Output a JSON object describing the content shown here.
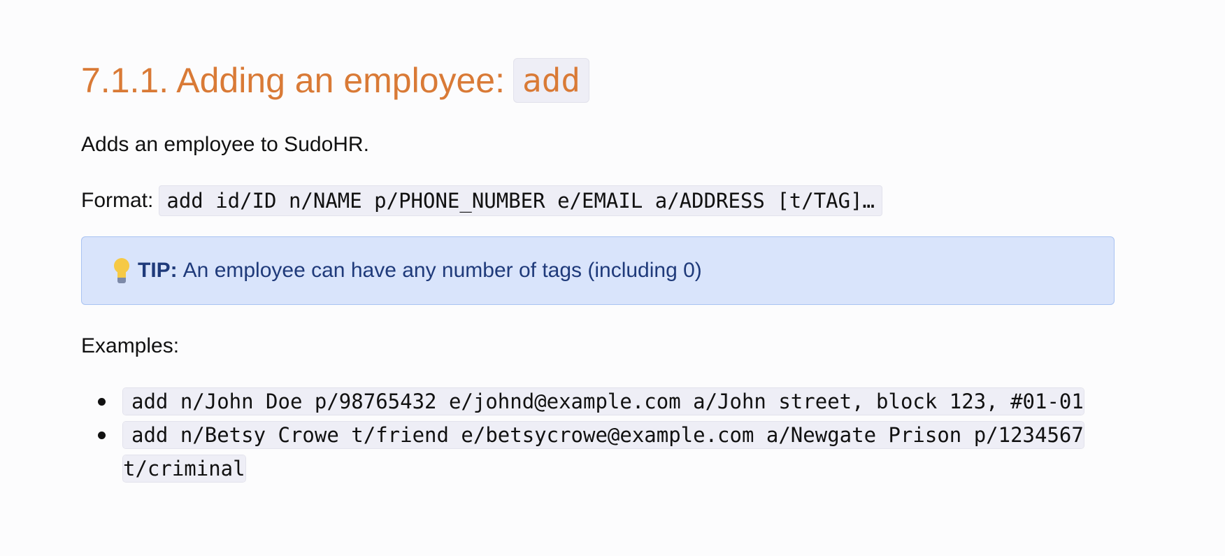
{
  "heading": {
    "text": "7.1.1. Adding an employee:",
    "code": "add"
  },
  "intro": "Adds an employee to SudoHR.",
  "format": {
    "label": "Format:",
    "code": "add id/ID n/NAME p/PHONE_NUMBER e/EMAIL a/ADDRESS [t/TAG]…"
  },
  "tip": {
    "icon": "lightbulb-icon",
    "label": "TIP:",
    "text": "An employee can have any number of tags (including 0)"
  },
  "examples": {
    "label": "Examples:",
    "items": [
      "add n/John Doe p/98765432 e/johnd@example.com a/John street, block 123, #01-01",
      "add n/Betsy Crowe t/friend e/betsycrowe@example.com a/Newgate Prison p/1234567 t/criminal"
    ]
  },
  "colors": {
    "heading": "#d97a36",
    "tip_background": "#d9e4fb",
    "tip_border": "#a9c3f2",
    "tip_text": "#1f3a7a",
    "code_background": "#eeeef6"
  }
}
